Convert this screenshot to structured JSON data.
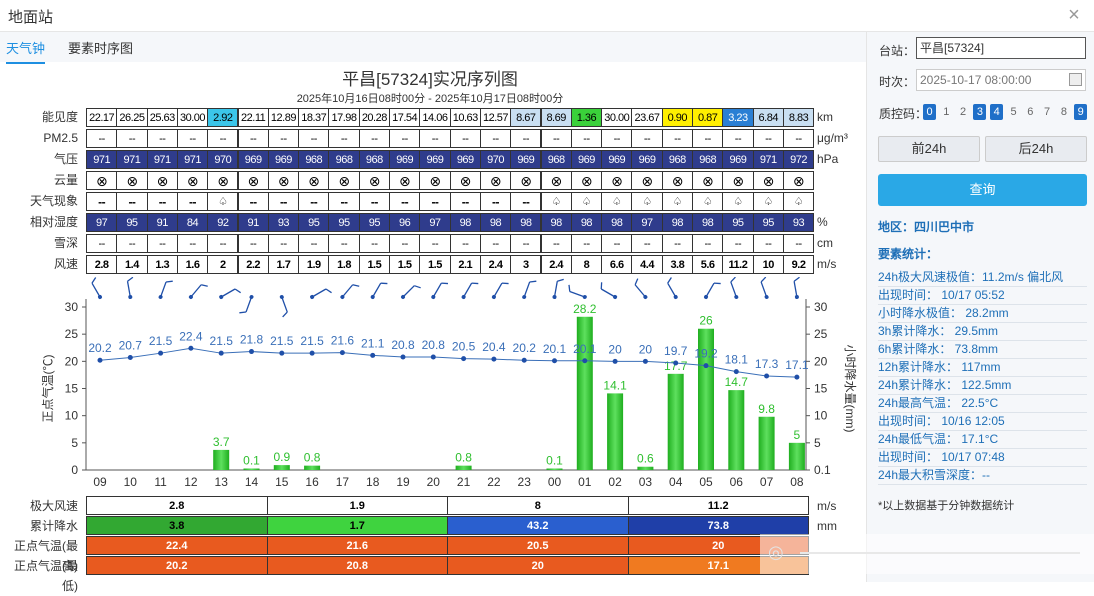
{
  "window": {
    "title": "地面站",
    "close_label": "×"
  },
  "tabs": [
    {
      "label": "天气钟"
    },
    {
      "label": "要素时序图"
    }
  ],
  "chart_header": {
    "title": "平昌[57324]实况序列图",
    "subtitle": "2025年10月16日08时00分 - 2025年10月17日08时00分"
  },
  "meteo_table": {
    "rows": [
      {
        "label": "能见度",
        "unit": "km",
        "values": [
          "22.17",
          "26.25",
          "25.63",
          "30.00",
          "2.92",
          "22.11",
          "12.89",
          "18.37",
          "17.98",
          "20.28",
          "17.54",
          "14.06",
          "10.63",
          "12.57",
          "8.67",
          "8.69",
          "1.36",
          "30.00",
          "23.67",
          "0.90",
          "0.87",
          "3.23",
          "6.84",
          "8.83"
        ]
      },
      {
        "label": "PM2.5",
        "unit": "μg/m³",
        "values": [
          "--",
          "--",
          "--",
          "--",
          "--",
          "--",
          "--",
          "--",
          "--",
          "--",
          "--",
          "--",
          "--",
          "--",
          "--",
          "--",
          "--",
          "--",
          "--",
          "--",
          "--",
          "--",
          "--",
          "--"
        ]
      },
      {
        "label": "气压",
        "unit": "hPa",
        "values": [
          "971",
          "971",
          "971",
          "971",
          "970",
          "969",
          "969",
          "968",
          "968",
          "968",
          "969",
          "969",
          "969",
          "970",
          "969",
          "968",
          "969",
          "969",
          "969",
          "968",
          "968",
          "969",
          "971",
          "972"
        ]
      },
      {
        "label": "云量",
        "unit": "",
        "values": [
          "⊗",
          "⊗",
          "⊗",
          "⊗",
          "⊗",
          "⊗",
          "⊗",
          "⊗",
          "⊗",
          "⊗",
          "⊗",
          "⊗",
          "⊗",
          "⊗",
          "⊗",
          "⊗",
          "⊗",
          "⊗",
          "⊗",
          "⊗",
          "⊗",
          "⊗",
          "⊗",
          "⊗"
        ]
      },
      {
        "label": "天气现象",
        "unit": "",
        "values": [
          "--",
          "--",
          "--",
          "--",
          "♤",
          "--",
          "--",
          "--",
          "--",
          "--",
          "--",
          "--",
          "--",
          "--",
          "--",
          "♤",
          "♤",
          "♤",
          "♤",
          "♤",
          "♤",
          "♤",
          "♤",
          "♤"
        ]
      },
      {
        "label": "相对湿度",
        "unit": "%",
        "values": [
          "97",
          "95",
          "91",
          "84",
          "92",
          "91",
          "93",
          "95",
          "95",
          "95",
          "96",
          "97",
          "98",
          "98",
          "98",
          "98",
          "98",
          "98",
          "97",
          "98",
          "98",
          "95",
          "95",
          "93"
        ]
      },
      {
        "label": "雪深",
        "unit": "cm",
        "values": [
          "--",
          "--",
          "--",
          "--",
          "--",
          "--",
          "--",
          "--",
          "--",
          "--",
          "--",
          "--",
          "--",
          "--",
          "--",
          "--",
          "--",
          "--",
          "--",
          "--",
          "--",
          "--",
          "--",
          "--"
        ]
      },
      {
        "label": "风速",
        "unit": "m/s",
        "values": [
          "2.8",
          "1.4",
          "1.3",
          "1.6",
          "2",
          "2.2",
          "1.7",
          "1.9",
          "1.8",
          "1.5",
          "1.5",
          "1.5",
          "2.1",
          "2.4",
          "3",
          "2.4",
          "8",
          "6.6",
          "4.4",
          "3.8",
          "5.6",
          "11.2",
          "10",
          "9.2"
        ]
      }
    ]
  },
  "chart_data": {
    "type": "bar+line",
    "x": [
      "09",
      "10",
      "11",
      "12",
      "13",
      "14",
      "15",
      "16",
      "17",
      "18",
      "19",
      "20",
      "21",
      "22",
      "23",
      "00",
      "01",
      "02",
      "03",
      "04",
      "05",
      "06",
      "07",
      "08"
    ],
    "ylabel_left": "正点气温(℃)",
    "ylabel_right": "小时降水量(mm)",
    "yticks_left": [
      "0",
      "5",
      "10",
      "15",
      "20",
      "25",
      "30"
    ],
    "yticks_right": [
      "0.1",
      "5",
      "10",
      "15",
      "20",
      "25",
      "30"
    ],
    "ylim": [
      0,
      30
    ],
    "series": [
      {
        "values": [
          20.2,
          20.7,
          21.5,
          22.4,
          21.5,
          21.8,
          21.5,
          21.5,
          21.6,
          21.1,
          20.8,
          20.8,
          20.5,
          20.4,
          20.2,
          20.1,
          20.1,
          20,
          20,
          19.7,
          19.2,
          18.1,
          17.3,
          17.1
        ],
        "color": "#3a6fb8"
      },
      {
        "values": [
          0,
          0,
          0,
          0,
          3.7,
          0.1,
          0.9,
          0.8,
          0,
          0,
          0,
          0,
          0.8,
          0,
          0,
          0.1,
          28.2,
          14.1,
          0.6,
          17.7,
          26,
          14.7,
          9.8,
          5
        ],
        "color": "#2fbf2f"
      }
    ],
    "wind_barb_directions_deg": [
      330,
      350,
      20,
      40,
      60,
      200,
      160,
      60,
      40,
      30,
      45,
      30,
      30,
      30,
      20,
      10,
      290,
      300,
      320,
      330,
      30,
      340,
      340,
      350
    ]
  },
  "bottom_table": {
    "rows": [
      {
        "label": "极大风速",
        "unit": "m/s",
        "values": [
          "2.8",
          "1.9",
          "8",
          "11.2"
        ]
      },
      {
        "label": "累计降水",
        "unit": "mm",
        "values": [
          "3.8",
          "1.7",
          "43.2",
          "73.8"
        ]
      },
      {
        "label": "正点气温(最高)",
        "unit": "",
        "values": [
          "22.4",
          "21.6",
          "20.5",
          "20"
        ]
      },
      {
        "label": "正点气温(最低)",
        "unit": "",
        "values": [
          "20.2",
          "20.8",
          "20",
          "17.1"
        ]
      }
    ]
  },
  "panel": {
    "station_label": "台站：",
    "station_value": "平昌[57324]",
    "time_label": "时次：",
    "time_value": "2025-10-17 08:00:00",
    "qc_label": "质控码：",
    "qc_codes": [
      "0",
      "1",
      "2",
      "3",
      "4",
      "5",
      "6",
      "7",
      "8",
      "9"
    ],
    "prev_label": "前24h",
    "next_label": "后24h",
    "query_label": "查询",
    "region": "地区：四川巴中市",
    "stats_title": "要素统计：",
    "stats": [
      "24h极大风速极值：11.2m/s 偏北风",
      "出现时间：        10/17 05:52",
      "小时降水极值：   28.2mm",
      "3h累计降水：       29.5mm",
      "6h累计降水：       73.8mm",
      "12h累计降水：     117mm",
      "24h累计降水：     122.5mm",
      "24h最高气温：     22.5°C",
      "出现时间：         10/16 12:05",
      "24h最低气温：     17.1°C",
      "出现时间：         10/17 07:48",
      "24h最大积雪深度：--"
    ],
    "note": "*以上数据基于分钟数据统计"
  },
  "colors": {
    "accent": "#1e8fe1",
    "query_button": "#2aa8e6",
    "navy_cell": "#2f3c8c",
    "rain_bar": "#2fbf2f",
    "temp_line": "#3a6fb8"
  }
}
